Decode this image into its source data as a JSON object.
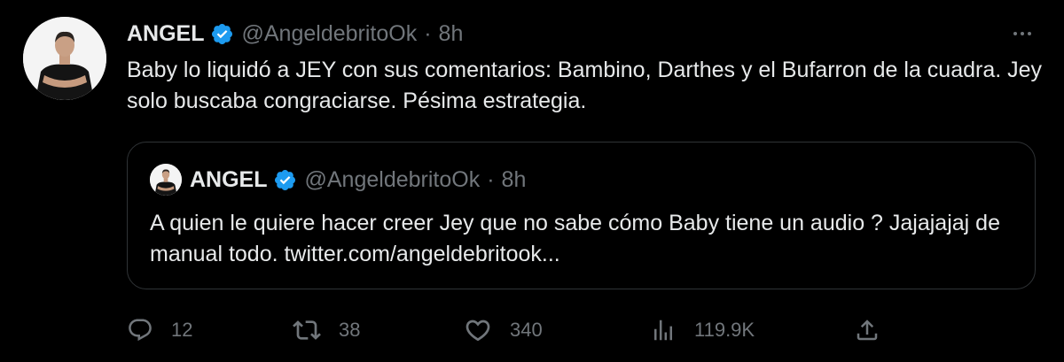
{
  "tweet": {
    "author_name": "ANGEL",
    "handle": "@AngeldebritoOk",
    "separator": "·",
    "time": "8h",
    "text": "Baby lo liquidó a JEY con sus comentarios: Bambino, Darthes y el Bufarron de la cuadra. Jey solo buscaba congraciarse. Pésima estrategia."
  },
  "quote": {
    "author_name": "ANGEL",
    "handle": "@AngeldebritoOk",
    "separator": "·",
    "time": "8h",
    "text": "A quien le quiere hacer creer Jey que no sabe cómo Baby tiene un audio ? Jajajajaj de manual todo. twitter.com/angeldebritook..."
  },
  "actions": {
    "replies": "12",
    "retweets": "38",
    "likes": "340",
    "views": "119.9K"
  },
  "icons": {
    "verified": "verified-badge-icon",
    "more": "more-horizontal-icon",
    "reply": "reply-icon",
    "retweet": "retweet-icon",
    "like": "heart-icon",
    "views": "views-chart-icon",
    "share": "share-icon"
  },
  "colors": {
    "background": "#000000",
    "text": "#e7e9ea",
    "muted": "#71767b",
    "verified": "#1d9bf0",
    "border": "#2f3336"
  }
}
